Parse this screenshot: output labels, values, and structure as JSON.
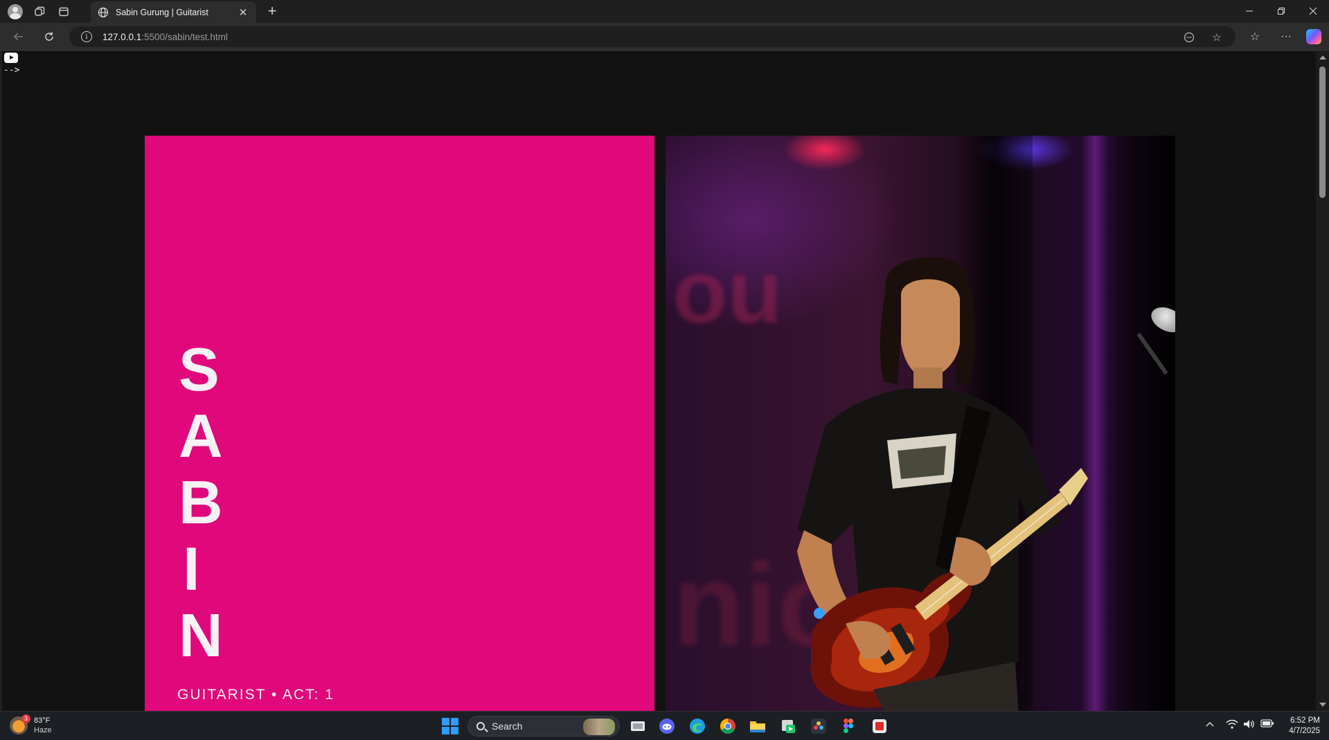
{
  "browser": {
    "tab": {
      "title": "Sabin Gurung | Guitarist"
    },
    "address": {
      "host": "127.0.0.1",
      "rest": ":5500/sabin/test.html"
    }
  },
  "page": {
    "comment_artifact": "-->",
    "hero": {
      "name_letters": [
        "S",
        "A",
        "B",
        "I",
        "N"
      ],
      "subtitle": "GUITARIST • ACT: 1",
      "accent_color": "#e0087a"
    },
    "photo": {
      "background_text_top": "ou",
      "background_text_bottom": "nic"
    }
  },
  "taskbar": {
    "weather": {
      "temp": "83°F",
      "condition": "Haze",
      "badge": "3"
    },
    "search_placeholder": "Search",
    "clock": {
      "time": "6:52 PM",
      "date": "4/7/2025"
    }
  }
}
